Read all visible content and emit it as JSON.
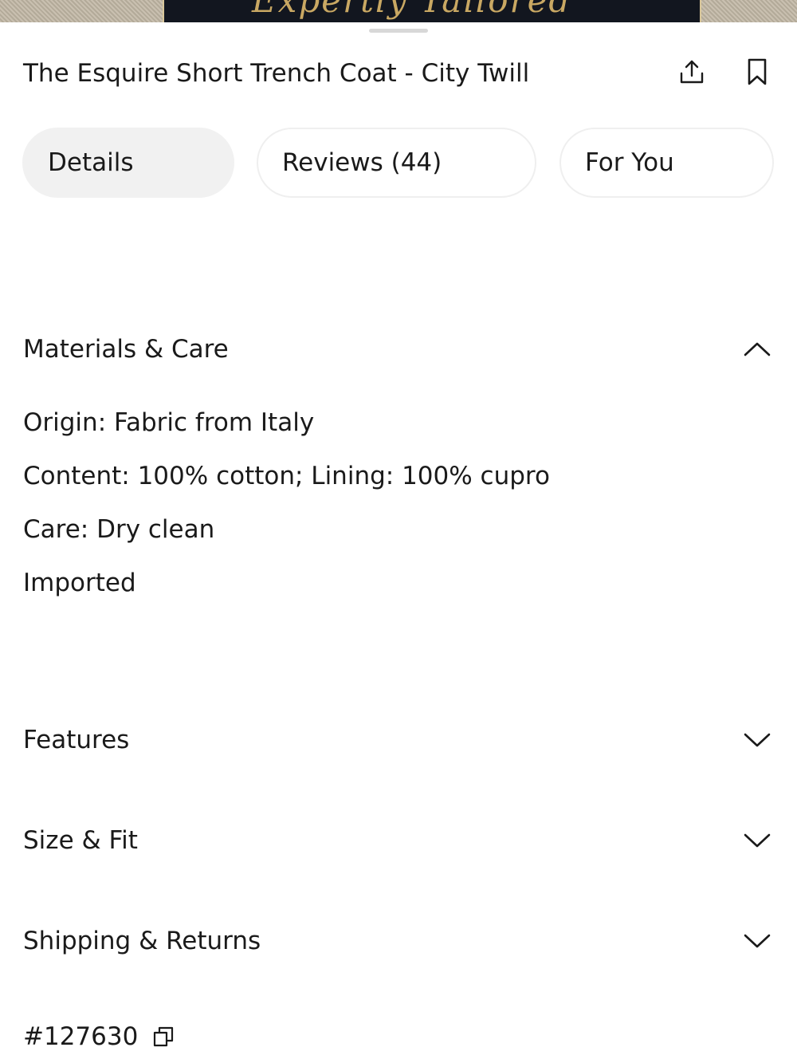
{
  "hero": {
    "label_text": "Expertly Tailored"
  },
  "product": {
    "title": "The Esquire Short Trench Coat - City Twill",
    "style_number": "#127630"
  },
  "header_icons": {
    "share": "share-icon",
    "bookmark": "bookmark-icon"
  },
  "tabs": [
    {
      "label": "Details",
      "active": true
    },
    {
      "label": "Reviews (44)",
      "active": false
    },
    {
      "label": "For You",
      "active": false
    }
  ],
  "sections": {
    "materials": {
      "title": "Materials & Care",
      "expanded": true,
      "lines": [
        "Origin: Fabric from Italy",
        "Content: 100% cotton; Lining: 100% cupro",
        "Care: Dry clean",
        "Imported"
      ]
    },
    "features": {
      "title": "Features",
      "expanded": false
    },
    "size_fit": {
      "title": "Size & Fit",
      "expanded": false
    },
    "shipping": {
      "title": "Shipping & Returns",
      "expanded": false
    }
  },
  "colors": {
    "text": "#1a1a1a",
    "tab_active_bg": "#f1f1f1",
    "tab_border": "#efefef",
    "grabber": "#d8d8d8"
  }
}
